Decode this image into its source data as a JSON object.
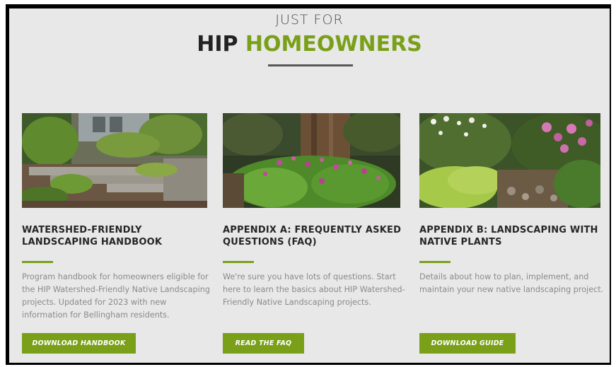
{
  "header": {
    "kicker": "JUST FOR",
    "headline_part1": "HIP ",
    "headline_part2": "HOMEOWNERS"
  },
  "colors": {
    "accent": "#7aa01a",
    "background": "#e8e8e8",
    "frame": "#000000"
  },
  "cards": [
    {
      "image_alt": "Landscaped garden with stone retaining wall",
      "title_line1": "WATERSHED-FRIENDLY",
      "title_line2": "LANDSCAPING HANDBOOK",
      "text_line1": "Program handbook for homeowners eligible for",
      "text_line2": "the HIP Watershed-Friendly Native Landscaping",
      "text_line3": "projects. Updated for 2023 with new",
      "text_line4": "information for Bellingham residents.",
      "button_label": "DOWNLOAD HANDBOOK"
    },
    {
      "image_alt": "Pink flowering groundcover under a large tree trunk",
      "title_line1": "APPENDIX A: FREQUENTLY ASKED",
      "title_line2": "QUESTIONS (FAQ)",
      "text_line1": "We're sure you have lots of questions. Start",
      "text_line2": "here to learn the basics about HIP Watershed-",
      "text_line3": "Friendly Native Landscaping projects.",
      "text_line4": "",
      "button_label": "READ THE FAQ"
    },
    {
      "image_alt": "Native plant garden with pink rhododendrons and white flowers",
      "title_line1": "APPENDIX B: LANDSCAPING WITH",
      "title_line2": "NATIVE PLANTS",
      "text_line1": "Details about how to plan, implement, and",
      "text_line2": "maintain your new native landscaping project.",
      "text_line3": "",
      "text_line4": "",
      "button_label": "DOWNLOAD GUIDE"
    }
  ]
}
